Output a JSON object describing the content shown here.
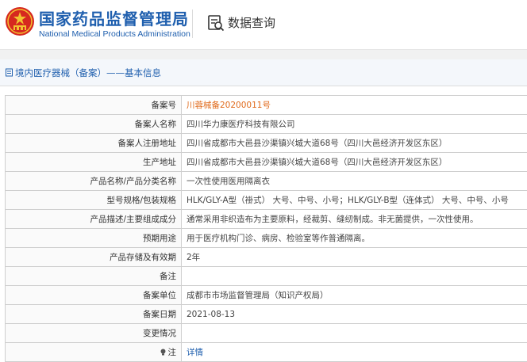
{
  "header": {
    "org_name_cn": "国家药品监督管理局",
    "org_name_en": "National Medical Products Administration",
    "query_title": "数据查询"
  },
  "section": {
    "title": "境内医疗器械（备案）——基本信息"
  },
  "rows": [
    {
      "label": "备案号",
      "value": "川蓉械备20200011号"
    },
    {
      "label": "备案人名称",
      "value": "四川华力康医疗科技有限公司"
    },
    {
      "label": "备案人注册地址",
      "value": "四川省成都市大邑县沙渠镇兴城大道68号（四川大邑经济开发区东区）"
    },
    {
      "label": "生产地址",
      "value": "四川省成都市大邑县沙渠镇兴城大道68号（四川大邑经济开发区东区）"
    },
    {
      "label": "产品名称/产品分类名称",
      "value": "一次性使用医用隔离衣"
    },
    {
      "label": "型号规格/包装规格",
      "value": "HLK/GLY-A型（褂式）  大号、中号、小号；HLK/GLY-B型（连体式）  大号、中号、小号"
    },
    {
      "label": "产品描述/主要组成成分",
      "value": "通常采用非织造布为主要原料，经裁剪、缝纫制成。非无菌提供，一次性使用。"
    },
    {
      "label": "预期用途",
      "value": "用于医疗机构门诊、病房、检验室等作普通隔离。"
    },
    {
      "label": "产品存储及有效期",
      "value": "2年"
    },
    {
      "label": "备注",
      "value": ""
    },
    {
      "label": "备案单位",
      "value": "成都市市场监督管理局（知识产权局）"
    },
    {
      "label": "备案日期",
      "value": "2021-08-13"
    },
    {
      "label": "变更情况",
      "value": ""
    },
    {
      "label": "注",
      "value": "详情"
    }
  ],
  "colors": {
    "brand_blue": "#1f5fae",
    "accent_orange": "#e06a1b"
  },
  "icons": {
    "logo": "national-emblem-icon",
    "query": "search-document-icon",
    "section": "document-icon",
    "note": "lightbulb-icon"
  }
}
